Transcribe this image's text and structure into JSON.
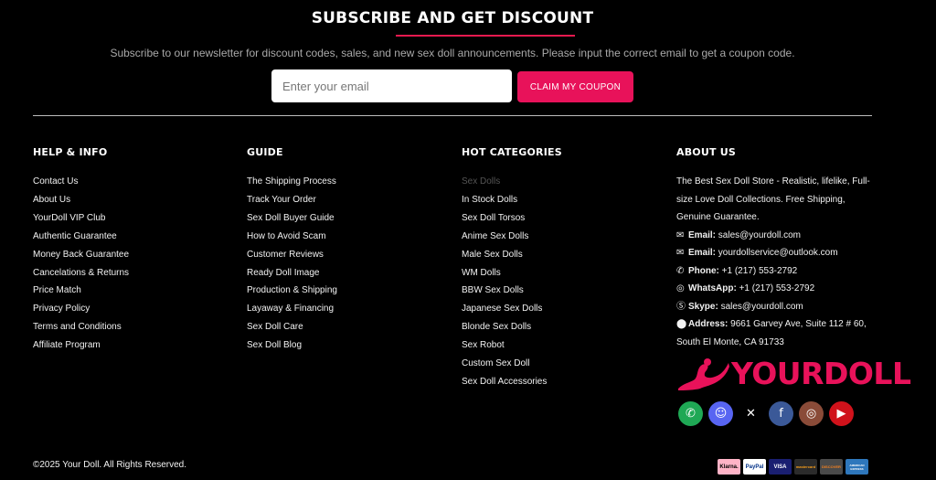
{
  "subscribe": {
    "title": "SUBSCRIBE AND GET DISCOUNT",
    "description": "Subscribe to our newsletter for discount codes, sales, and new sex doll announcements. Please input the correct email to get a coupon code.",
    "email_placeholder": "Enter your email",
    "button_label": "CLAIM MY COUPON"
  },
  "help": {
    "title": "HELP & INFO",
    "items": [
      "Contact Us",
      "About Us",
      "YourDoll VIP Club",
      "Authentic Guarantee",
      "Money Back Guarantee",
      "Cancelations & Returns",
      "Price Match",
      "Privacy Policy",
      "Terms and Conditions",
      "Affiliate Program"
    ]
  },
  "guide": {
    "title": "GUIDE",
    "items": [
      "The Shipping Process",
      "Track Your Order",
      "Sex Doll Buyer Guide",
      "How to Avoid Scam",
      "Customer Reviews",
      "Ready Doll Image",
      "Production & Shipping",
      "Layaway & Financing",
      "Sex Doll Care",
      "Sex Doll Blog"
    ]
  },
  "categories": {
    "title": "HOT CATEGORIES",
    "items": [
      "Sex Dolls",
      "In Stock Dolls",
      "Sex Doll Torsos",
      "Anime Sex Dolls",
      "Male Sex Dolls",
      "WM Dolls",
      "BBW Sex Dolls",
      "Japanese Sex Dolls",
      "Blonde Sex Dolls",
      "Sex Robot",
      "Custom Sex Doll",
      "Sex Doll Accessories"
    ]
  },
  "about": {
    "title": "ABOUT US",
    "text": "The Best Sex Doll Store - Realistic, lifelike, Full-size Love Doll Collections. Free Shipping, Genuine Guarantee.",
    "contacts": [
      {
        "icon": "envelope-icon",
        "label": "Email:",
        "value": "sales@yourdoll.com"
      },
      {
        "icon": "envelope-icon",
        "label": "Email:",
        "value": "yourdollservice@outlook.com"
      },
      {
        "icon": "phone-icon",
        "label": "Phone:",
        "value": "+1 (217) 553-2792"
      },
      {
        "icon": "whatsapp-icon",
        "label": "WhatsApp:",
        "value": "+1 (217) 553-2792"
      },
      {
        "icon": "skype-icon",
        "label": "Skype:",
        "value": "sales@yourdoll.com"
      },
      {
        "icon": "map-marker-icon",
        "label": "Address:",
        "value": "9661 Garvey Ave, Suite 112 # 60, South El Monte, CA 91733"
      }
    ]
  },
  "logo": {
    "text": "YOURDOLL",
    "color": "#e8125a"
  },
  "socials": [
    {
      "name": "whatsapp-icon",
      "color": "#1fa855"
    },
    {
      "name": "discord-icon",
      "color": "#5865f2"
    },
    {
      "name": "x-icon",
      "color": "#000000"
    },
    {
      "name": "facebook-icon",
      "color": "#3b5998"
    },
    {
      "name": "instagram-icon",
      "color": "#8a4b38"
    },
    {
      "name": "youtube-icon",
      "color": "#d0121b"
    }
  ],
  "copyright": "©2025 Your Doll. All Rights Reserved.",
  "payments": [
    "Klarna.",
    "PayPal",
    "VISA",
    "mastercard",
    "DISCOVER",
    "AMERICAN EXPRESS"
  ]
}
